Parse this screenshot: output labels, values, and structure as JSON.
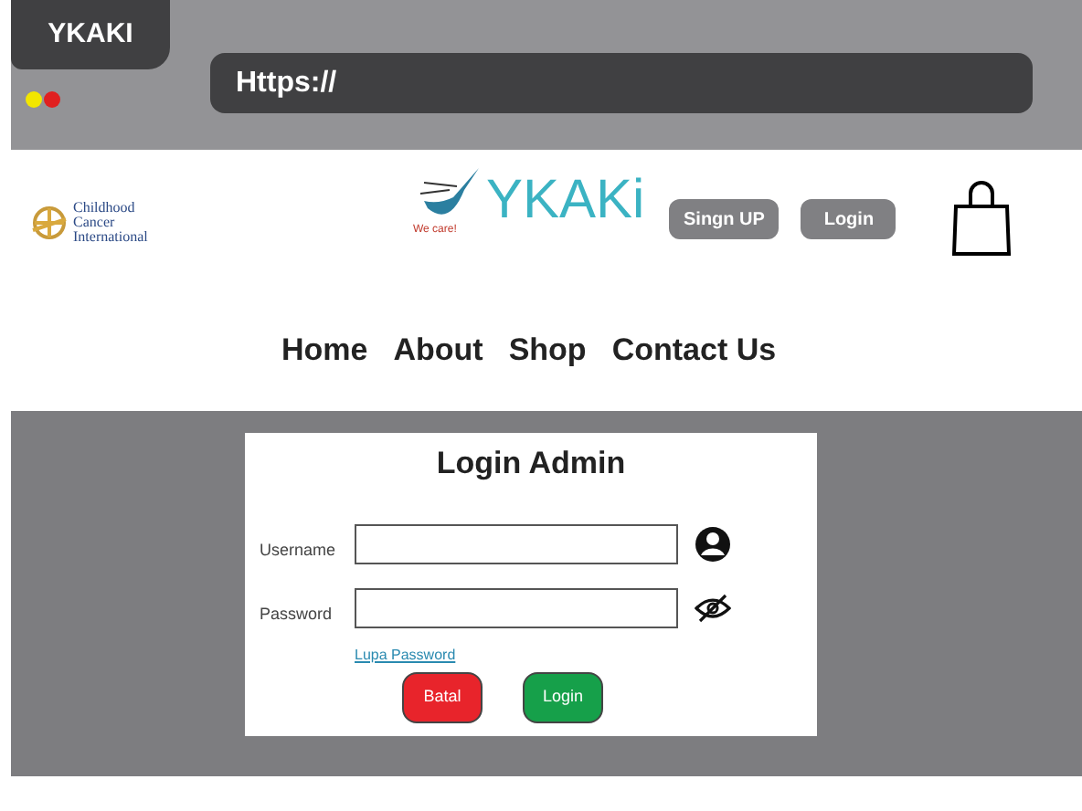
{
  "browser": {
    "tab_title": "YKAKI",
    "address": "Https://",
    "dots": [
      {
        "color": "#f2e600"
      },
      {
        "color": "#e02020"
      }
    ]
  },
  "header": {
    "partner_logo": "Childhood Cancer International",
    "logo": {
      "name": "YKAKi",
      "tagline": "We care!"
    },
    "buttons": [
      "Singn UP",
      "Login"
    ]
  },
  "nav": [
    "Home",
    "About",
    "Shop",
    "Contact Us"
  ],
  "login": {
    "title": "Login Admin",
    "fields": [
      {
        "label": "Username",
        "kind": "user"
      },
      {
        "label": "Password",
        "kind": "password"
      }
    ],
    "forgot_link": "Lupa Password",
    "buttons": [
      {
        "label": "Batal",
        "kind": "cancel"
      },
      {
        "label": "Login",
        "kind": "submit"
      }
    ]
  }
}
